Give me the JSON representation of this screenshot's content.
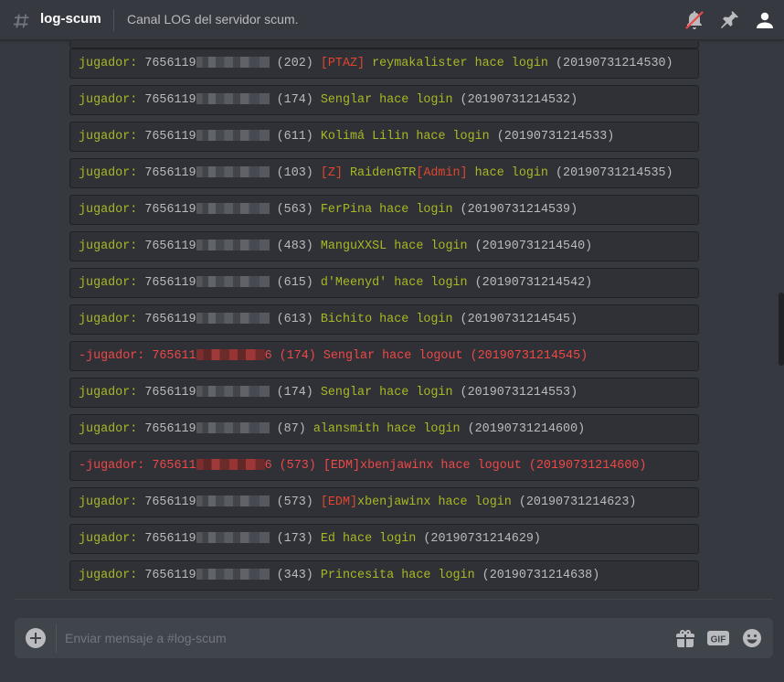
{
  "header": {
    "channel": "log-scum",
    "topic": "Canal LOG del servidor scum."
  },
  "messages": [
    {
      "type": "login",
      "prefix": "jugador:",
      "id": "7656119",
      "num": "(202)",
      "tag": "[PTAZ]",
      "name": " reymakalister",
      "action": " hace login",
      "ts": " (20190731214530)"
    },
    {
      "type": "login",
      "prefix": "jugador:",
      "id": "7656119",
      "num": "(174)",
      "tag": "",
      "name": " Senglar",
      "action": " hace login",
      "ts": " (20190731214532)"
    },
    {
      "type": "login",
      "prefix": "jugador:",
      "id": "7656119",
      "num": "(611)",
      "tag": "",
      "name": " Kolimá Lilin",
      "action": " hace login",
      "ts": " (20190731214533)"
    },
    {
      "type": "login",
      "prefix": "jugador:",
      "id": "7656119",
      "num": "(103)",
      "tag": "[Z]",
      "name": " RaidenGTR",
      "tag2": "[Admin]",
      "action": " hace login",
      "ts": " (20190731214535)"
    },
    {
      "type": "login",
      "prefix": "jugador:",
      "id": "7656119",
      "num": "(563)",
      "tag": "",
      "name": " FerPina",
      "action": " hace login",
      "ts": " (20190731214539)"
    },
    {
      "type": "login",
      "prefix": "jugador:",
      "id": "7656119",
      "num": "(483)",
      "tag": "",
      "name": " ManguXXSL",
      "action": " hace login",
      "ts": " (20190731214540)"
    },
    {
      "type": "login",
      "prefix": "jugador:",
      "id": "7656119",
      "num": "(615)",
      "tag": "",
      "name": " d'Meenyd'",
      "action": " hace login",
      "ts": " (20190731214542)"
    },
    {
      "type": "login",
      "prefix": "jugador:",
      "id": "7656119",
      "num": "(613)",
      "tag": "",
      "name": " Bichito",
      "action": " hace login",
      "ts": " (20190731214545)"
    },
    {
      "type": "logout",
      "text": "-jugador: 765611",
      "tail": "6 (174) Senglar hace logout (20190731214545)"
    },
    {
      "type": "login",
      "prefix": "jugador:",
      "id": "7656119",
      "num": "(174)",
      "tag": "",
      "name": " Senglar",
      "action": " hace login",
      "ts": " (20190731214553)"
    },
    {
      "type": "login",
      "prefix": "jugador:",
      "id": "7656119",
      "num": "(87)",
      "tag": "",
      "name": " alansmith",
      "action": " hace login",
      "ts": " (20190731214600)"
    },
    {
      "type": "logout",
      "text": "-jugador: 765611",
      "tail": "6 (573) [EDM]xbenjawinx hace logout (20190731214600)"
    },
    {
      "type": "login",
      "prefix": "jugador:",
      "id": "7656119",
      "num": "(573)",
      "tag": "[EDM]",
      "name": "xbenjawinx",
      "action": " hace login",
      "ts": " (20190731214623)"
    },
    {
      "type": "login",
      "prefix": "jugador:",
      "id": "7656119",
      "num": "(173)",
      "tag": "",
      "name": " Ed",
      "action": " hace login",
      "ts": " (20190731214629)"
    },
    {
      "type": "login",
      "prefix": "jugador:",
      "id": "7656119",
      "num": "(343)",
      "tag": "",
      "name": " Princesita",
      "action": " hace login",
      "ts": " (20190731214638)"
    }
  ],
  "composer": {
    "placeholder": "Enviar mensaje a #log-scum"
  },
  "icons": {
    "hash": "hash-icon",
    "mute": "bell-muted-icon",
    "pin": "pin-icon",
    "members": "members-icon",
    "upload": "plus-circle-icon",
    "gift": "gift-icon",
    "gif": "gif-icon",
    "emoji": "emoji-icon"
  },
  "colors": {
    "green": "#a9b824",
    "red": "#f04747",
    "orange_red": "#e0452f",
    "bg": "#36393f"
  }
}
